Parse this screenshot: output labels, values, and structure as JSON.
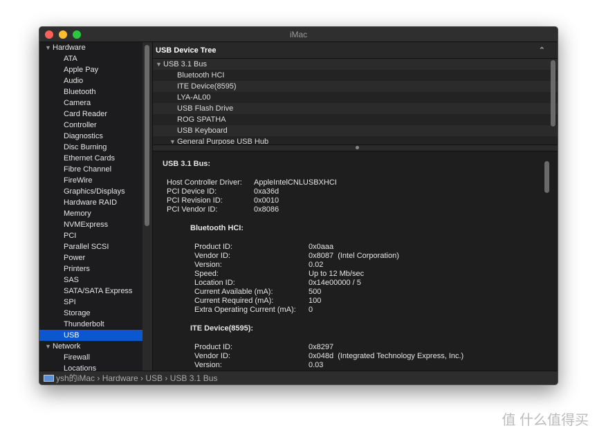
{
  "window": {
    "title": "iMac",
    "lights": {
      "close": "#fe5f57",
      "minimize": "#febc2e",
      "zoom": "#28c840"
    }
  },
  "sidebar": {
    "groups": [
      {
        "label": "Hardware",
        "items": [
          "ATA",
          "Apple Pay",
          "Audio",
          "Bluetooth",
          "Camera",
          "Card Reader",
          "Controller",
          "Diagnostics",
          "Disc Burning",
          "Ethernet Cards",
          "Fibre Channel",
          "FireWire",
          "Graphics/Displays",
          "Hardware RAID",
          "Memory",
          "NVMExpress",
          "PCI",
          "Parallel SCSI",
          "Power",
          "Printers",
          "SAS",
          "SATA/SATA Express",
          "SPI",
          "Storage",
          "Thunderbolt",
          "USB"
        ]
      },
      {
        "label": "Network",
        "items": [
          "Firewall",
          "Locations"
        ]
      }
    ],
    "selected": "USB",
    "selected_color": "#0a57d0"
  },
  "tree": {
    "header": "USB Device Tree",
    "root": "USB 3.1 Bus",
    "children": [
      "Bluetooth HCI",
      "ITE Device(8595)",
      "LYA-AL00",
      "USB Flash Drive",
      "ROG SPATHA",
      "USB Keyboard"
    ],
    "hub": "General Purpose USB Hub"
  },
  "detail": {
    "bus_title": "USB 3.1 Bus:",
    "bus_props": [
      [
        "Host Controller Driver:",
        "AppleIntelCNLUSBXHCI"
      ],
      [
        "PCI Device ID:",
        "0xa36d"
      ],
      [
        "PCI Revision ID:",
        "0x0010"
      ],
      [
        "PCI Vendor ID:",
        "0x8086"
      ]
    ],
    "devices": [
      {
        "title": "Bluetooth HCI:",
        "props": [
          [
            "Product ID:",
            "0x0aaa"
          ],
          [
            "Vendor ID:",
            "0x8087  (Intel Corporation)"
          ],
          [
            "Version:",
            "0.02"
          ],
          [
            "Speed:",
            "Up to 12 Mb/sec"
          ],
          [
            "Location ID:",
            "0x14e00000 / 5"
          ],
          [
            "Current Available (mA):",
            "500"
          ],
          [
            "Current Required (mA):",
            "100"
          ],
          [
            "Extra Operating Current (mA):",
            "0"
          ]
        ]
      },
      {
        "title": "ITE Device(8595):",
        "props": [
          [
            "Product ID:",
            "0x8297"
          ],
          [
            "Vendor ID:",
            "0x048d  (Integrated Technology Express, Inc.)"
          ],
          [
            "Version:",
            "0.03"
          ]
        ]
      }
    ]
  },
  "statusbar": {
    "path": [
      "ysh的iMac",
      "Hardware",
      "USB",
      "USB 3.1 Bus"
    ],
    "icon": "imac-icon"
  },
  "watermark": "值 什么值得买"
}
